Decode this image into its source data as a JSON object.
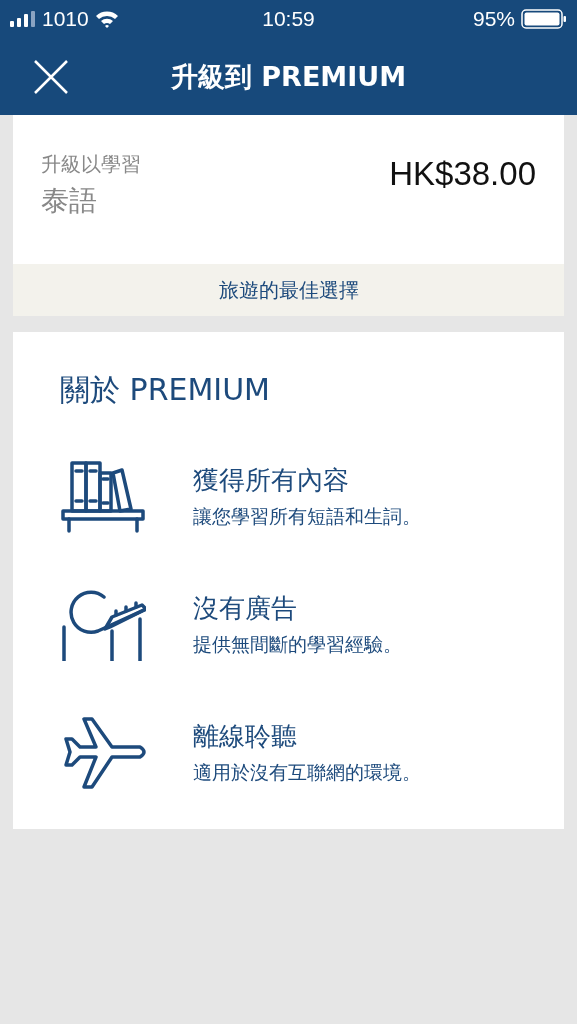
{
  "status_bar": {
    "carrier": "1010",
    "time": "10:59",
    "battery": "95%"
  },
  "nav": {
    "title": "升級到 PREMIUM"
  },
  "offer": {
    "label": "升級以學習",
    "language": "泰語",
    "price": "HK$38.00",
    "tagline": "旅遊的最佳選擇"
  },
  "about": {
    "heading": "關於 PREMIUM",
    "features": [
      {
        "kind": "books",
        "title": "獲得所有內容",
        "text": "讓您學習所有短語和生詞。"
      },
      {
        "kind": "coaster",
        "title": "沒有廣告",
        "text": "提供無間斷的學習經驗。"
      },
      {
        "kind": "plane",
        "title": "離線聆聽",
        "text": "適用於沒有互聯網的環境。"
      }
    ]
  }
}
